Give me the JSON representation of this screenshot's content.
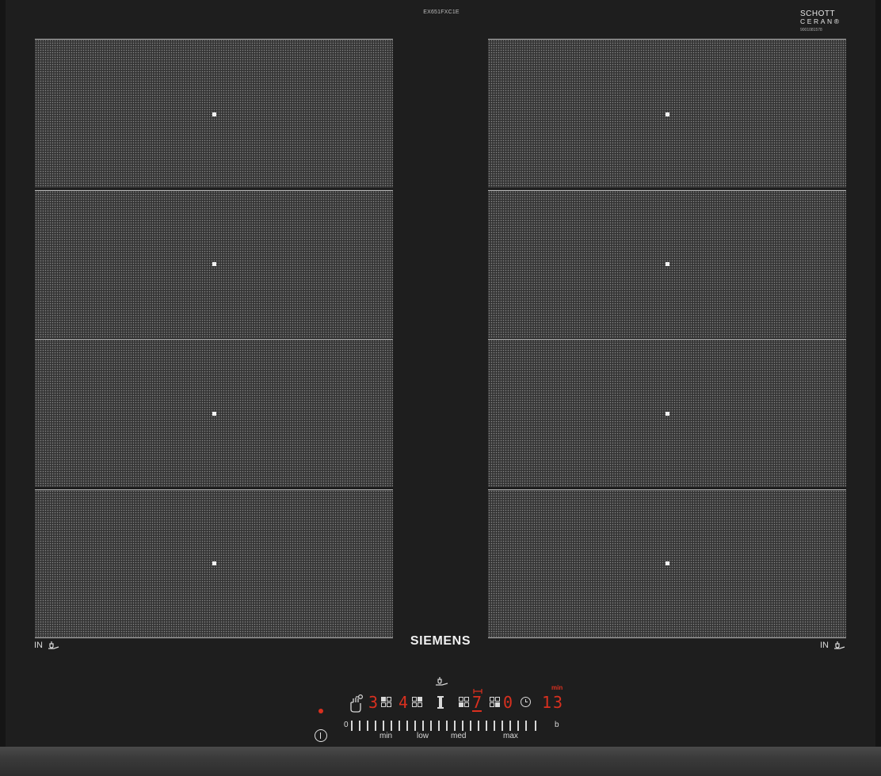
{
  "header": {
    "model": "EX651FXC1E",
    "glass_brand_line1": "SCHOTT",
    "glass_brand_line2": "CERAN®",
    "glass_code": "9001081578"
  },
  "brand": "SIEMENS",
  "zones": {
    "left": [
      "zone-left-1",
      "zone-left-2",
      "zone-left-3",
      "zone-left-4"
    ],
    "right": [
      "zone-right-1",
      "zone-right-2",
      "zone-right-3",
      "zone-right-4"
    ]
  },
  "flex_labels": {
    "left": "IN",
    "right": "IN"
  },
  "control_panel": {
    "display_1": "3",
    "display_2": "4",
    "display_3": "7",
    "display_4": "0",
    "timer_value": "13",
    "timer_unit": "min",
    "slider_zero": "0",
    "slider_end": "b",
    "slider_labels": {
      "min": "min",
      "low": "low",
      "med": "med",
      "max": "max"
    },
    "colors": {
      "display": "#d9301f",
      "text": "#d8d8d8"
    },
    "icons": [
      "childlock-hand-icon",
      "zone-grid-icon",
      "pan-icon",
      "power-boost-icon",
      "clock-icon",
      "power-icon"
    ]
  }
}
